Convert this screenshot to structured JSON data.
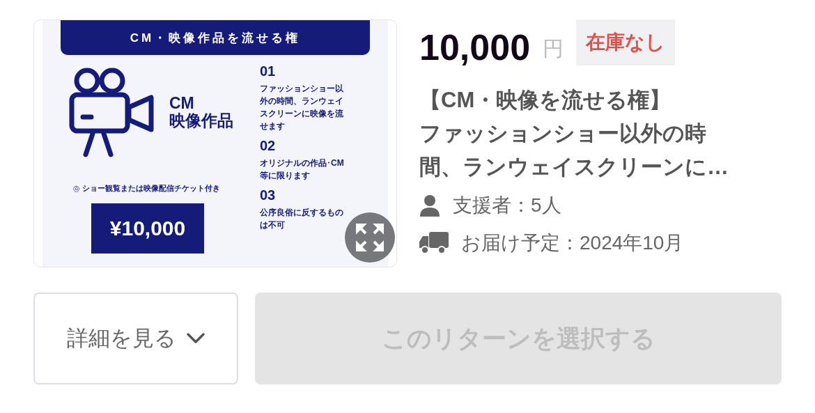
{
  "image": {
    "header": "CM・映像作品を流せる権",
    "heading_lines": [
      "CM",
      "映像作品"
    ],
    "note": "◎ ショー観覧または映像配信チケット付き",
    "price_tag": "¥10,000",
    "points": [
      {
        "number": "01",
        "text": "ファッションショー以外の時間、ランウェイスクリーンに映像を流せます"
      },
      {
        "number": "02",
        "text": "オリジナルの作品･CM等に限ります"
      },
      {
        "number": "03",
        "text": "公序良俗に反するものは不可"
      }
    ]
  },
  "price": {
    "amount": "10,000",
    "unit": "円"
  },
  "stock_badge": "在庫なし",
  "title_lines": [
    "【CM・映像を流せる権】",
    "ファッションショー以外の時",
    "間、ランウェイスクリーンに…"
  ],
  "meta": [
    {
      "kind": "supporters",
      "text": "支援者：5人"
    },
    {
      "kind": "delivery",
      "text": "お届け予定：2024年10月"
    }
  ],
  "details_button": {
    "label": "詳細を見る",
    "expanded": false
  },
  "select_button": {
    "label": "このリターンを選択する",
    "disabled": true
  }
}
